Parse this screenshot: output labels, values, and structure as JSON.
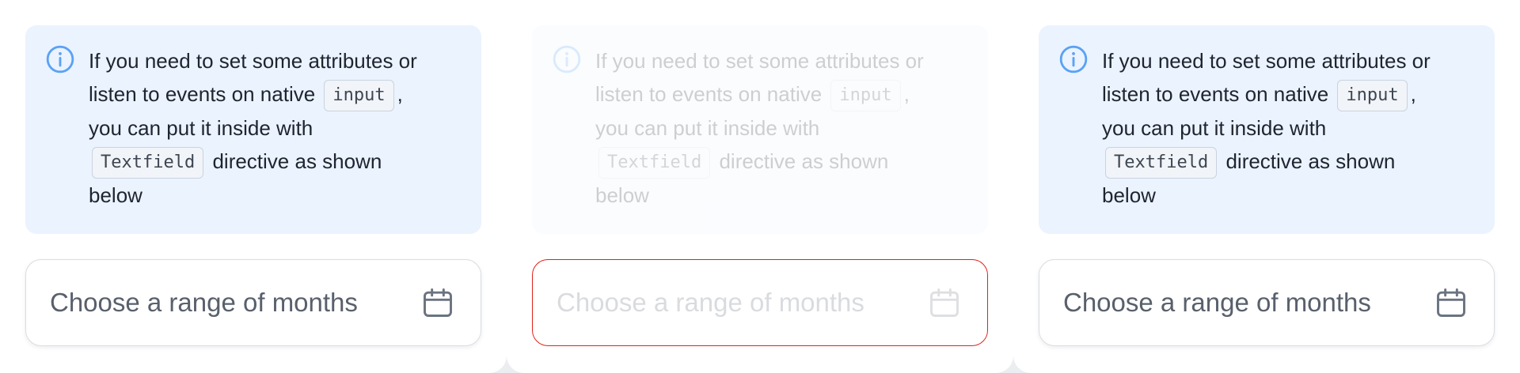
{
  "alert": {
    "line1": "If you need to set some attributes or",
    "line2_before": "listen to events on native",
    "code_input": "input",
    "line2_after": ",",
    "line3": "you can put it inside with",
    "code_textfield": "Textfield",
    "line4_after": "directive as shown",
    "line5": "below"
  },
  "field": {
    "placeholder": "Choose a range of months",
    "icon": "calendar-icon"
  },
  "colors": {
    "alert_background": "#ebf3fe",
    "info_icon": "#5aa2f5",
    "error_border": "#e0231b",
    "placeholder_text": "#58606c"
  },
  "states": [
    "normal",
    "disabled-invalid",
    "normal"
  ]
}
